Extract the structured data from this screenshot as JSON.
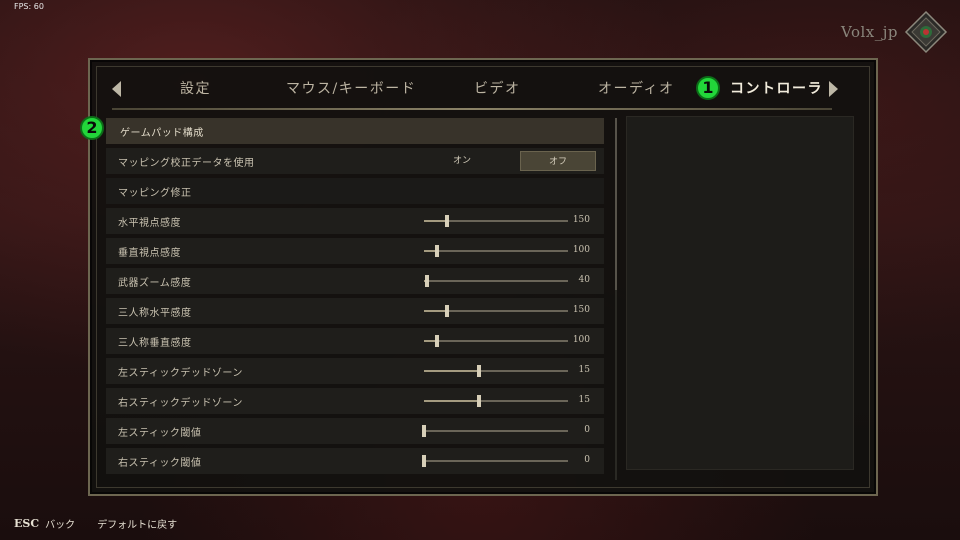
{
  "hud": {
    "fps": "FPS: 60"
  },
  "user": {
    "name": "Volx_jp"
  },
  "tabs": [
    {
      "label": "設定",
      "active": false
    },
    {
      "label": "マウス/キーボード",
      "active": false
    },
    {
      "label": "ビデオ",
      "active": false
    },
    {
      "label": "オーディオ",
      "active": false
    },
    {
      "label": "コントローラ",
      "active": true
    }
  ],
  "markers": {
    "one": "1",
    "two": "2"
  },
  "settings": {
    "header": "ゲームパッド構成",
    "calibration": {
      "label": "マッピング校正データを使用",
      "on": "オン",
      "off": "オフ",
      "selected": "オフ"
    },
    "section": "マッピング修正",
    "sliders": [
      {
        "label": "水平視点感度",
        "value": "150",
        "level": 0.16
      },
      {
        "label": "垂直視点感度",
        "value": "100",
        "level": 0.09
      },
      {
        "label": "武器ズーム感度",
        "value": "40",
        "level": 0.02
      },
      {
        "label": "三人称水平感度",
        "value": "150",
        "level": 0.16
      },
      {
        "label": "三人称垂直感度",
        "value": "100",
        "level": 0.09
      },
      {
        "label": "左スティックデッドゾーン",
        "value": "15",
        "level": 0.38
      },
      {
        "label": "右スティックデッドゾーン",
        "value": "15",
        "level": 0.38
      },
      {
        "label": "左スティック閾値",
        "value": "0",
        "level": 0.0
      },
      {
        "label": "右スティック閾値",
        "value": "0",
        "level": 0.0
      }
    ]
  },
  "footer": {
    "esc_key": "ESC",
    "back": "バック",
    "defaults": "デフォルトに戻す"
  },
  "colors": {
    "accent": "#22d63a",
    "panel_border": "#6d6650"
  }
}
